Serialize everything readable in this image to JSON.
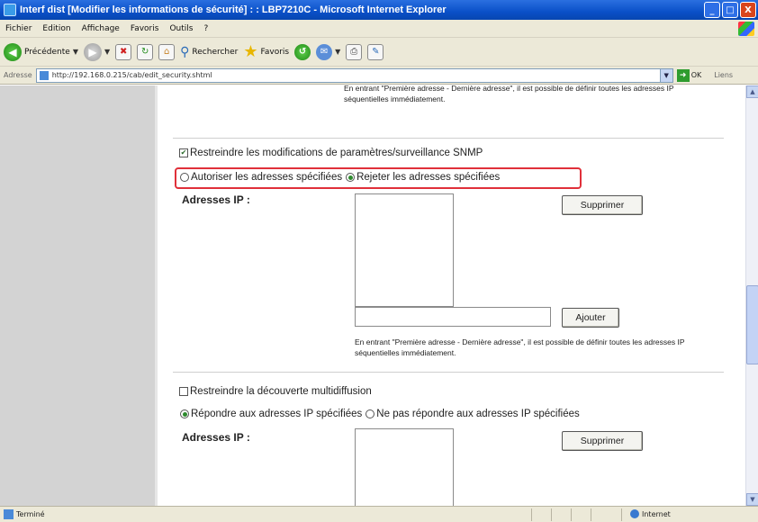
{
  "window": {
    "title": "Interf dist [Modifier les informations de sécurité] : : LBP7210C - Microsoft Internet Explorer",
    "min_label": "_",
    "max_label": "□",
    "close_label": "X"
  },
  "menu": [
    "Fichier",
    "Edition",
    "Affichage",
    "Favoris",
    "Outils",
    "?"
  ],
  "toolbar": {
    "back_label": "Précédente",
    "search_label": "Rechercher",
    "favorites_label": "Favoris"
  },
  "address": {
    "label": "Adresse",
    "url": "http://192.168.0.215/cab/edit_security.shtml",
    "go_label": "OK",
    "links_label": "Liens"
  },
  "content": {
    "note_top": "En entrant \"Première adresse - Dernière adresse\", il est possible de définir toutes les adresses IP séquentielles immédiatement.",
    "snmp": {
      "checkbox_label": "Restreindre les modifications de paramètres/surveillance SNMP",
      "checked": true,
      "radio_allow": "Autoriser les adresses spécifiées",
      "radio_reject": "Rejeter les adresses spécifiées",
      "selected": "reject",
      "ip_label": "Adresses IP :",
      "delete_button": "Supprimer",
      "add_button": "Ajouter",
      "add_input_value": "",
      "note": "En entrant \"Première adresse - Dernière adresse\", il est possible de définir toutes les adresses IP séquentielles immédiatement."
    },
    "multicast": {
      "checkbox_label": "Restreindre la découverte multidiffusion",
      "checked": false,
      "radio_respond": "Répondre aux adresses IP spécifiées",
      "radio_no_respond": "Ne pas répondre aux adresses IP spécifiées",
      "selected": "respond",
      "ip_label": "Adresses IP :",
      "delete_button": "Supprimer"
    }
  },
  "status": {
    "text": "Terminé",
    "zone": "Internet"
  }
}
